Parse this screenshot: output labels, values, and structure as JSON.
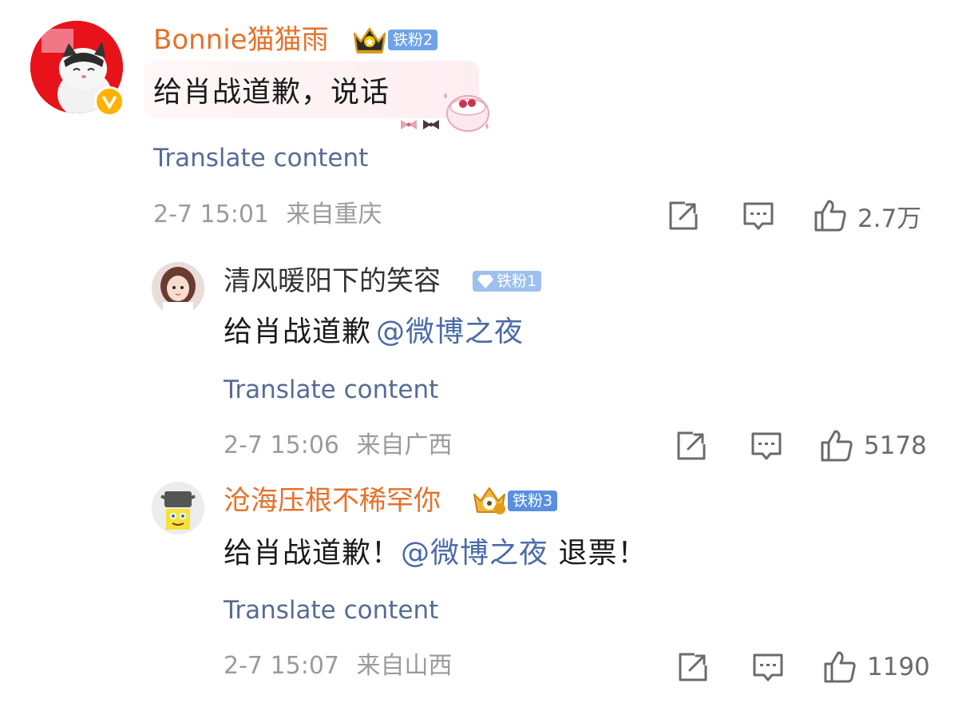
{
  "comments": [
    {
      "username": "Bonnie猫猫雨",
      "username_color": "#e5712c",
      "badge": "铁粉2",
      "badge_color": "#6fa3e8",
      "text": "给肖战道歉，说话",
      "translate": "Translate content",
      "date": "2-7 15:01",
      "location": "来自重庆",
      "likes": "2.7万"
    },
    {
      "username": "清风暖阳下的笑容",
      "username_color": "#333333",
      "badge": "铁粉1",
      "badge_color": "#9cc0ef",
      "text_prefix": "给肖战道歉",
      "mention": "@微博之夜",
      "translate": "Translate content",
      "date": "2-7 15:06",
      "location": "来自广西",
      "likes": "5178"
    },
    {
      "username": "沧海压根不稀罕你",
      "username_color": "#e5712c",
      "badge": "铁粉3",
      "badge_color": "#5a8fe0",
      "text_prefix": "给肖战道歉！",
      "mention": "@微博之夜",
      "text_suffix": " 退票！",
      "translate": "Translate content",
      "date": "2-7 15:07",
      "location": "来自山西",
      "likes": "1190"
    }
  ],
  "icons": {
    "repost": "repost-icon",
    "comment": "comment-icon",
    "like": "thumbs-up-icon",
    "verified": "verified-v-icon",
    "crown": "crown-icon"
  }
}
